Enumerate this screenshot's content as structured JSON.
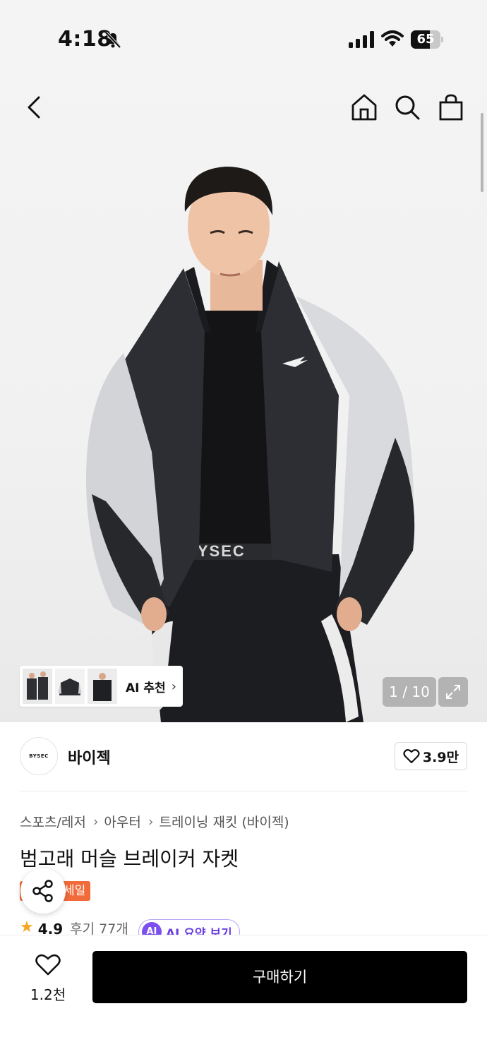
{
  "status_bar": {
    "time": "4:18",
    "battery_level": "65",
    "icons": [
      "bell-slash-icon",
      "cellular-signal-icon",
      "wifi-icon",
      "battery-icon"
    ]
  },
  "nav": {
    "icons": [
      "chevron-left-icon",
      "home-icon",
      "search-icon",
      "shopping-bag-icon"
    ]
  },
  "gallery": {
    "ai_chip_label": "AI 추천",
    "page_counter": "1 / 10",
    "print": "BYSEC"
  },
  "brand": {
    "logo_text": "BYSEC",
    "name": "바이젝",
    "like_count": "3.9만"
  },
  "product": {
    "breadcrumb": [
      "스포츠/레저",
      "아우터",
      "트레이닝 재킷 (바이젝)"
    ],
    "title": "범고래 머슬 브레이커 자켓",
    "badge": "세일",
    "rating": "4.9",
    "reviews": "후기 77개",
    "ai_summary_badge": "AI",
    "ai_summary_label": "AI 요약 보기"
  },
  "bottom_bar": {
    "favorite_count": "1.2천",
    "buy_label": "구매하기"
  },
  "colors": {
    "sale_badge": "#f26b3a",
    "ai_purple": "#7b4ff0",
    "buy_button": "#000000",
    "star": "#f5a623"
  }
}
